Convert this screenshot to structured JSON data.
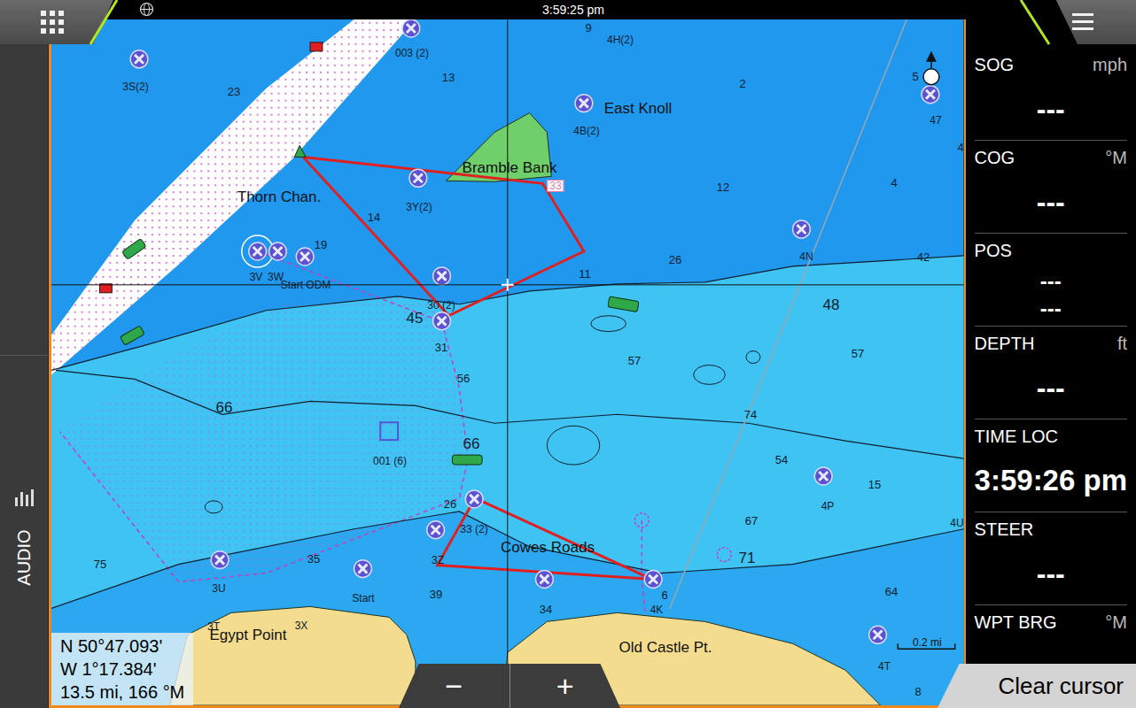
{
  "top_bar": {
    "time": "3:59:25 pm"
  },
  "sidebar": {
    "label": "AUDIO"
  },
  "instruments": [
    {
      "label": "SOG",
      "unit": "mph",
      "kind": "reading",
      "values": [
        "---"
      ]
    },
    {
      "label": "COG",
      "unit": "°M",
      "kind": "reading",
      "values": [
        "---"
      ]
    },
    {
      "label": "POS",
      "kind": "pair",
      "values": [
        "---",
        "---"
      ]
    },
    {
      "label": "DEPTH",
      "unit": "ft",
      "kind": "reading",
      "values": [
        "---"
      ]
    },
    {
      "label": "TIME LOC",
      "kind": "time",
      "values": [
        "3:59:26 pm"
      ]
    },
    {
      "label": "STEER",
      "kind": "reading",
      "values": [
        "---"
      ]
    },
    {
      "label": "WPT BRG",
      "unit": "°M",
      "kind": "reading",
      "values": []
    }
  ],
  "map": {
    "labels": [
      {
        "text": "3S(2)",
        "kind": "mark"
      },
      {
        "text": "23",
        "kind": "depth"
      },
      {
        "text": "003 (2)",
        "kind": "mark"
      },
      {
        "text": "13",
        "kind": "depth"
      },
      {
        "text": "9",
        "kind": "depth"
      },
      {
        "text": "4H(2)",
        "kind": "mark"
      },
      {
        "text": "East Knoll",
        "kind": "place"
      },
      {
        "text": "2",
        "kind": "depth"
      },
      {
        "text": "5",
        "kind": "depth"
      },
      {
        "text": "47",
        "kind": "mark"
      },
      {
        "text": "4",
        "kind": "depth"
      },
      {
        "text": "4B(2)",
        "kind": "mark"
      },
      {
        "text": "Bramble Bank",
        "kind": "place"
      },
      {
        "text": "12",
        "kind": "depth"
      },
      {
        "text": "4",
        "kind": "depth"
      },
      {
        "text": "Thorn Chan.",
        "kind": "place"
      },
      {
        "text": "3Y(2)",
        "kind": "mark"
      },
      {
        "text": "14",
        "kind": "depth"
      },
      {
        "text": "19",
        "kind": "depth"
      },
      {
        "text": "4N",
        "kind": "mark"
      },
      {
        "text": "42",
        "kind": "depth"
      },
      {
        "text": "26",
        "kind": "depth"
      },
      {
        "text": "3V",
        "kind": "mark"
      },
      {
        "text": "3W",
        "kind": "mark"
      },
      {
        "text": "Start ODM",
        "kind": "mark"
      },
      {
        "text": "11",
        "kind": "depth"
      },
      {
        "text": "30 (2)",
        "kind": "mark"
      },
      {
        "text": "45",
        "kind": "spot"
      },
      {
        "text": "48",
        "kind": "spot"
      },
      {
        "text": "31",
        "kind": "depth"
      },
      {
        "text": "57",
        "kind": "depth"
      },
      {
        "text": "57",
        "kind": "depth"
      },
      {
        "text": "56",
        "kind": "depth"
      },
      {
        "text": "66",
        "kind": "spot"
      },
      {
        "text": "74",
        "kind": "depth"
      },
      {
        "text": "001 (6)",
        "kind": "mark"
      },
      {
        "text": "66",
        "kind": "spot"
      },
      {
        "text": "54",
        "kind": "depth"
      },
      {
        "text": "15",
        "kind": "depth"
      },
      {
        "text": "4P",
        "kind": "mark"
      },
      {
        "text": "26",
        "kind": "depth"
      },
      {
        "text": "33 (2)",
        "kind": "mark"
      },
      {
        "text": "67",
        "kind": "depth"
      },
      {
        "text": "4U",
        "kind": "mark"
      },
      {
        "text": "Cowes Roads",
        "kind": "place"
      },
      {
        "text": "71",
        "kind": "spot"
      },
      {
        "text": "75",
        "kind": "depth"
      },
      {
        "text": "35",
        "kind": "depth"
      },
      {
        "text": "3Z",
        "kind": "mark"
      },
      {
        "text": "3U",
        "kind": "mark"
      },
      {
        "text": "Start",
        "kind": "mark"
      },
      {
        "text": "39",
        "kind": "depth"
      },
      {
        "text": "34",
        "kind": "depth"
      },
      {
        "text": "6",
        "kind": "depth"
      },
      {
        "text": "4K",
        "kind": "mark"
      },
      {
        "text": "64",
        "kind": "depth"
      },
      {
        "text": "3T",
        "kind": "mark"
      },
      {
        "text": "3X",
        "kind": "mark"
      },
      {
        "text": "Egypt Point",
        "kind": "place"
      },
      {
        "text": "Old Castle Pt.",
        "kind": "place"
      },
      {
        "text": "4T",
        "kind": "mark"
      },
      {
        "text": "8",
        "kind": "depth"
      },
      {
        "text": "33",
        "kind": "waypoint"
      }
    ],
    "scale": "0.2 mi",
    "cursor_position": {
      "lat": "N 50°47.093'",
      "lon": "W 1°17.384'",
      "range": "13.5 mi, 166 °M"
    }
  },
  "zoom_buttons": [
    "−",
    "+"
  ],
  "clear_cursor": "Clear cursor"
}
